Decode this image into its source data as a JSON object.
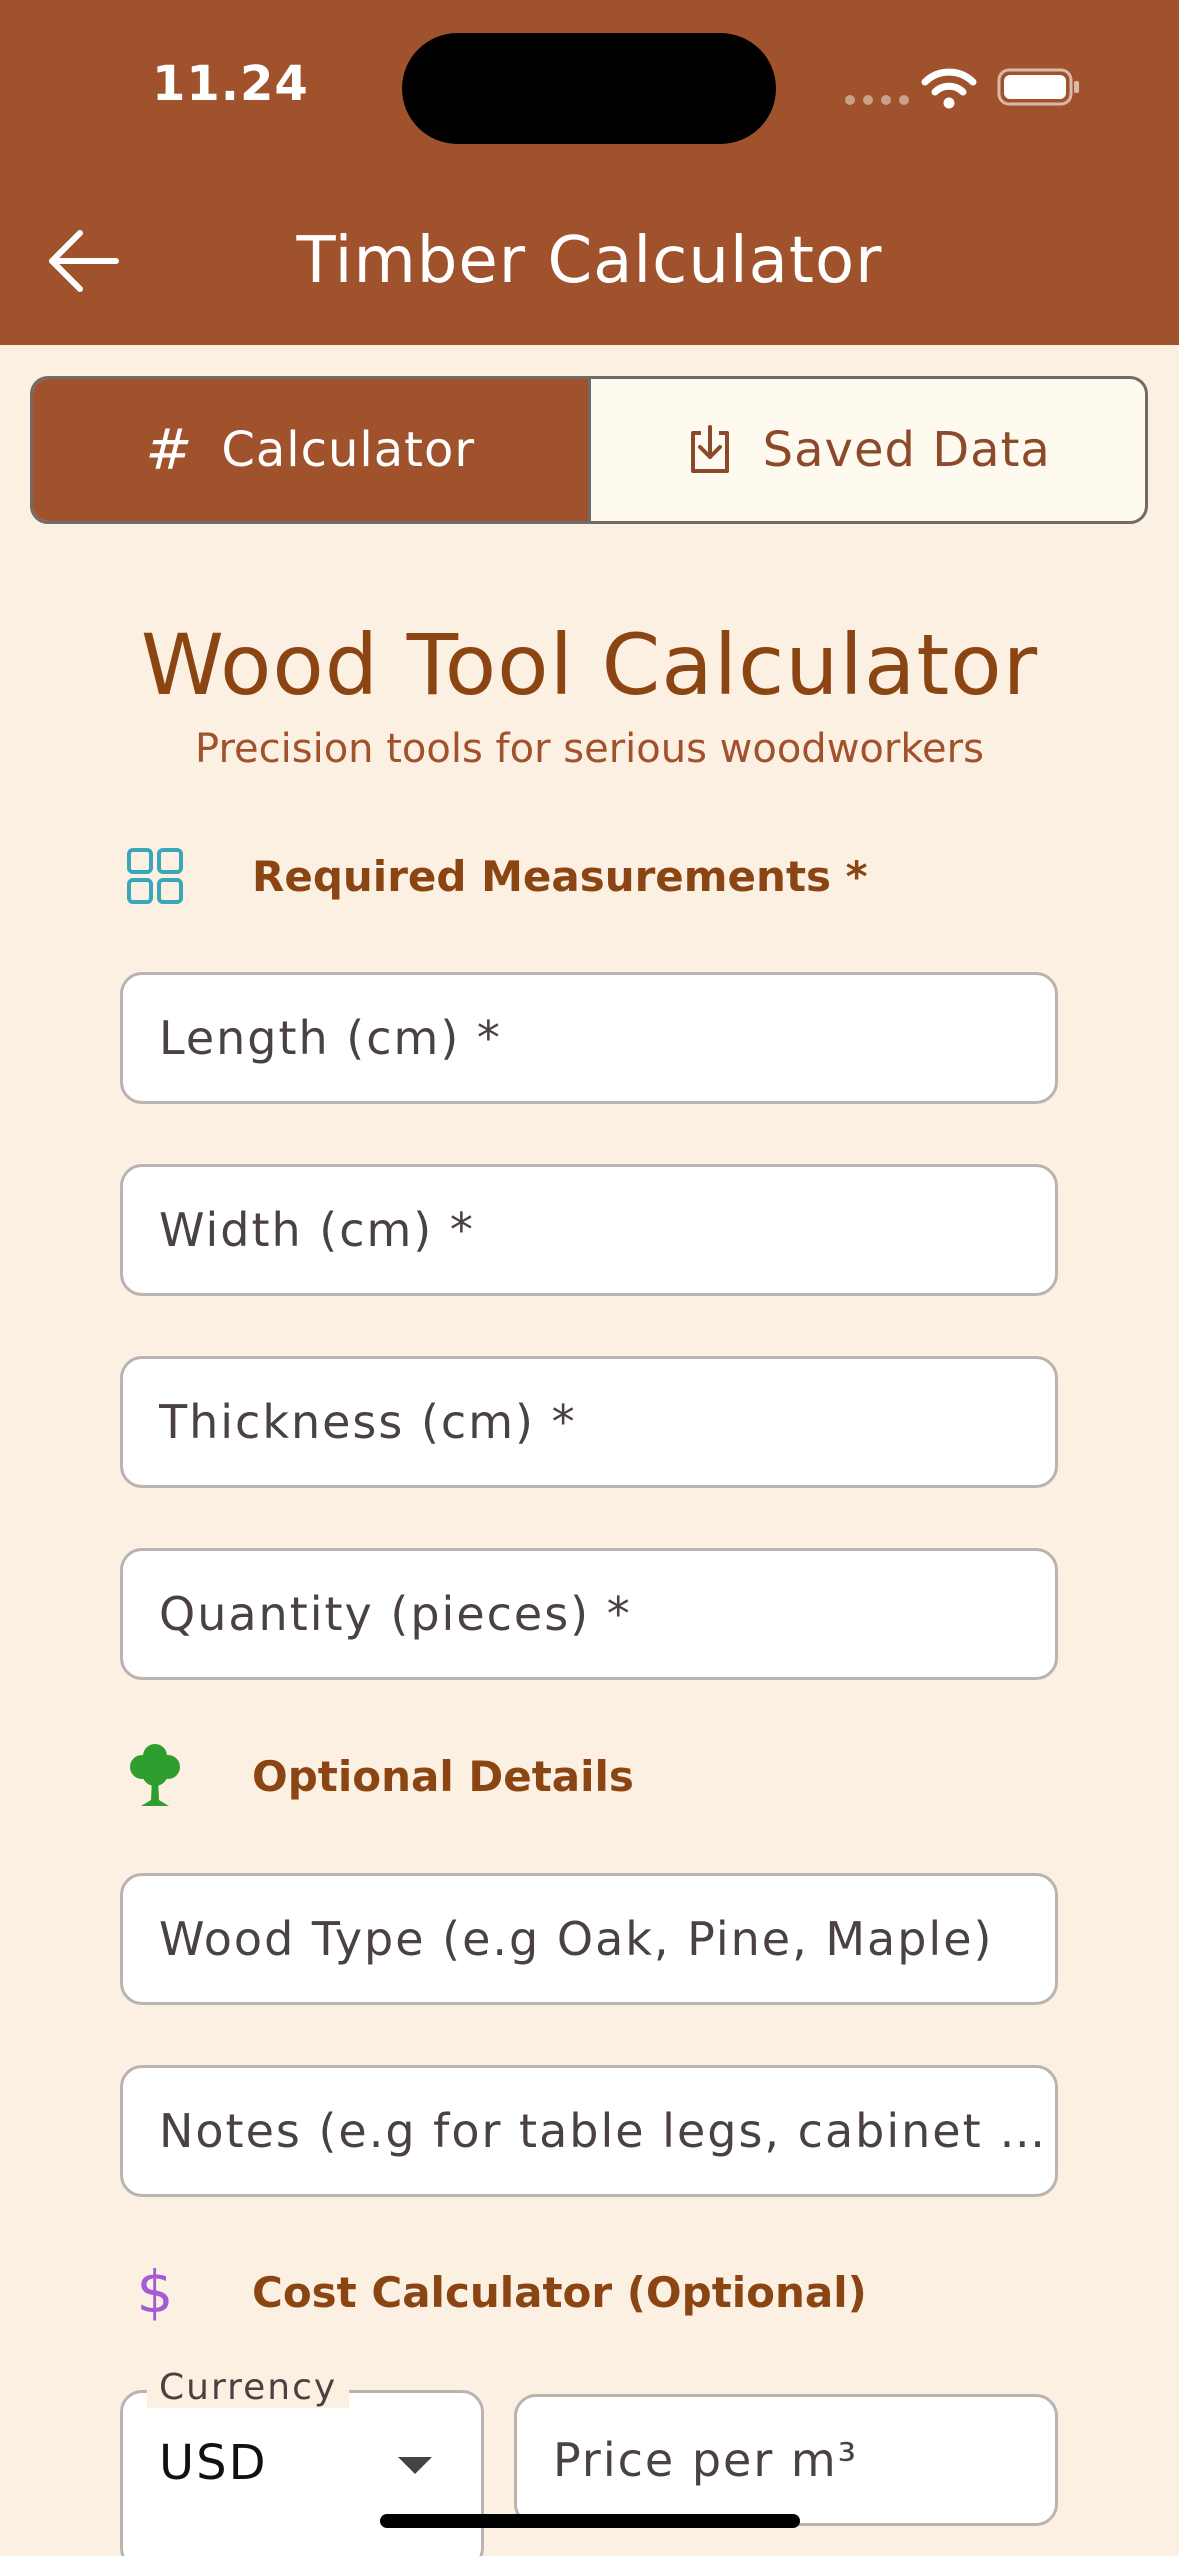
{
  "status_bar": {
    "time": "11.24"
  },
  "app_bar": {
    "title": "Timber Calculator"
  },
  "tabs": [
    {
      "label": "Calculator",
      "icon": "hash-icon",
      "active": true
    },
    {
      "label": "Saved Data",
      "icon": "download-icon",
      "active": false
    }
  ],
  "page": {
    "title": "Wood Tool Calculator",
    "subtitle": "Precision tools for serious woodworkers"
  },
  "sections": {
    "required": {
      "label": "Required Measurements *",
      "icon": "grid-icon",
      "icon_color": "#3AA6B9"
    },
    "optional": {
      "label": "Optional Details",
      "icon": "tree-icon",
      "icon_color": "#2E9E2E"
    },
    "cost": {
      "label": "Cost Calculator (Optional)",
      "icon": "dollar-icon",
      "icon_color": "#A45BD6"
    }
  },
  "fields": {
    "length": {
      "placeholder": "Length (cm) *",
      "value": ""
    },
    "width": {
      "placeholder": "Width (cm) *",
      "value": ""
    },
    "thickness": {
      "placeholder": "Thickness (cm) *",
      "value": ""
    },
    "quantity": {
      "placeholder": "Quantity (pieces) *",
      "value": ""
    },
    "wood_type": {
      "placeholder": "Wood Type (e.g Oak, Pine, Maple)",
      "value": ""
    },
    "notes": {
      "placeholder": "Notes (e.g for table legs, cabinet …",
      "value": ""
    },
    "price": {
      "placeholder": "Price per m³",
      "value": ""
    }
  },
  "currency": {
    "label": "Currency",
    "selected": "USD"
  },
  "colors": {
    "app_bar": "#A0522D",
    "background": "#FCF0E2",
    "heading": "#8B4513"
  }
}
